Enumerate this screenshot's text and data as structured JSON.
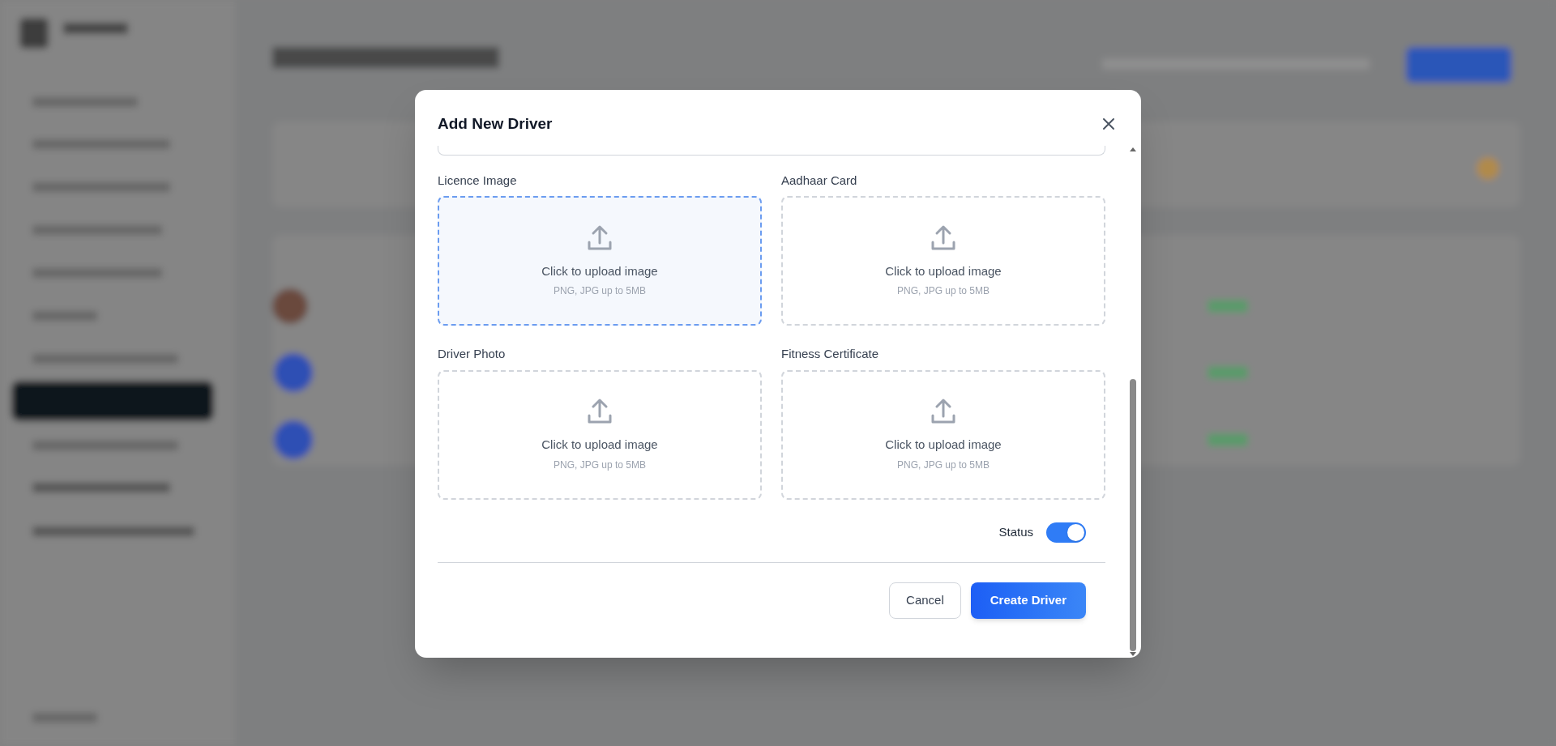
{
  "dialog": {
    "title": "Add New Driver",
    "uploads": [
      {
        "label": "Licence Image",
        "prompt": "Click to upload image",
        "hint": "PNG, JPG up to 5MB",
        "active": true
      },
      {
        "label": "Aadhaar Card",
        "prompt": "Click to upload image",
        "hint": "PNG, JPG up to 5MB",
        "active": false
      },
      {
        "label": "Driver Photo",
        "prompt": "Click to upload image",
        "hint": "PNG, JPG up to 5MB",
        "active": false
      },
      {
        "label": "Fitness Certificate",
        "prompt": "Click to upload image",
        "hint": "PNG, JPG up to 5MB",
        "active": false
      }
    ],
    "status": {
      "label": "Status",
      "on": true
    },
    "buttons": [
      {
        "label": "Cancel",
        "kind": "secondary"
      },
      {
        "label": "Create Driver",
        "kind": "primary"
      }
    ]
  }
}
